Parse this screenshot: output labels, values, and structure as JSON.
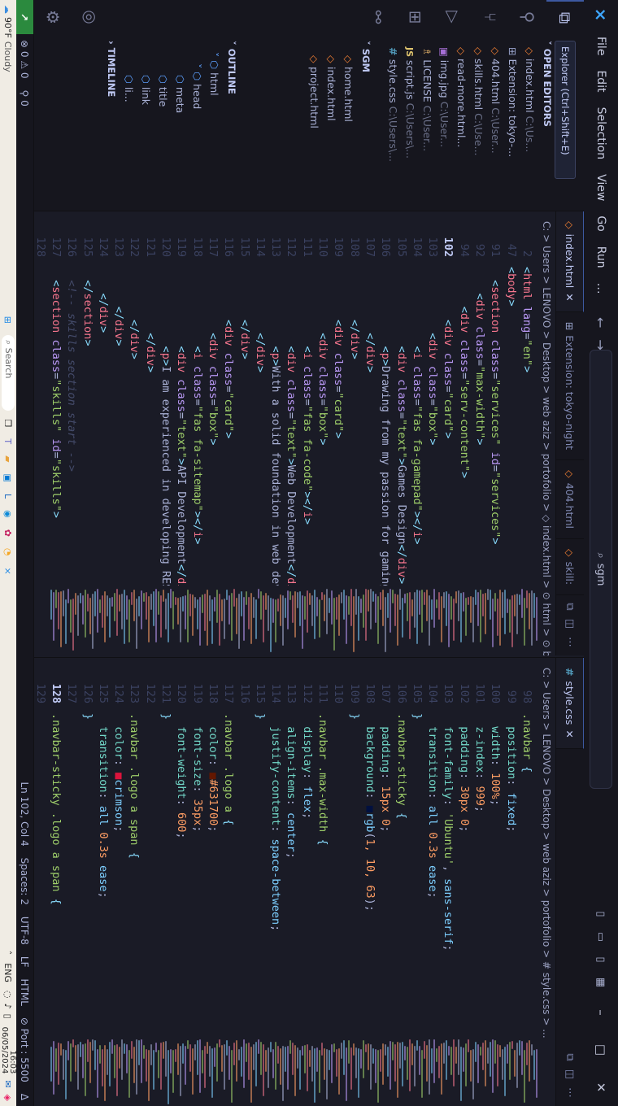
{
  "titlebar": {
    "menu": [
      "File",
      "Edit",
      "Selection",
      "View",
      "Go",
      "Run",
      "…"
    ],
    "search_text": "sgm",
    "win_min": "–",
    "win_max": "□",
    "win_close": "✕"
  },
  "tooltip": "Explorer (Ctrl+Shift+E)",
  "sidebar": {
    "open_editors_title": "OPEN EDITORS",
    "open_editors": [
      {
        "name": "index.html",
        "path": "C:\\Us...",
        "icon": "html"
      },
      {
        "name": "Extension: tokyo-...",
        "path": "",
        "icon": "ext"
      },
      {
        "name": "404.html",
        "path": "C:\\User...",
        "icon": "html"
      },
      {
        "name": "skills.html",
        "path": "C:\\Use...",
        "icon": "html"
      },
      {
        "name": "read-more.html...",
        "path": "",
        "icon": "html"
      },
      {
        "name": "img.jpg",
        "path": "C:\\User...",
        "icon": "img"
      },
      {
        "name": "LICENSE",
        "path": "C:\\User...",
        "icon": "lic"
      },
      {
        "name": "script.js",
        "path": "C:\\Users\\...",
        "icon": "js"
      },
      {
        "name": "style.css",
        "path": "C:\\Users\\...",
        "icon": "css"
      }
    ],
    "sgm_title": "SGM",
    "sgm_files": [
      "home.html",
      "index.html",
      "project.html"
    ],
    "outline_title": "OUTLINE",
    "outline": [
      {
        "label": "html",
        "indent": 1
      },
      {
        "label": "head",
        "indent": 2
      },
      {
        "label": "meta",
        "indent": 3
      },
      {
        "label": "title",
        "indent": 3
      },
      {
        "label": "link",
        "indent": 3
      },
      {
        "label": "li...",
        "indent": 3
      }
    ],
    "timeline_title": "TIMELINE"
  },
  "editor_left": {
    "tabs": [
      {
        "label": "index.html",
        "active": true,
        "icon": "html",
        "close": "✕"
      },
      {
        "label": "Extension: tokyo-night",
        "active": false,
        "icon": "ext"
      },
      {
        "label": "404.html",
        "active": false,
        "icon": "html"
      },
      {
        "label": "skill:",
        "active": false,
        "icon": "html"
      }
    ],
    "breadcrumb": "C: > Users > LENOVO > Desktop > web aziz > portofolio > ◇ index.html > ⊙ html > ⊙ body >",
    "lines": [
      {
        "n": "2",
        "html": "<span class='br'>&lt;</span><span class='tg'>html</span> <span class='at'>lang</span>=<span class='st'>\"en\"</span><span class='br'>&gt;</span>"
      },
      {
        "n": "47",
        "html": "<span class='br'>&lt;</span><span class='tg'>body</span><span class='br'>&gt;</span>"
      },
      {
        "n": "91",
        "html": "  <span class='br'>&lt;</span><span class='tg'>section</span> <span class='at'>class</span>=<span class='st'>\"services\"</span> <span class='at'>id</span>=<span class='st'>\"services\"</span><span class='br'>&gt;</span>"
      },
      {
        "n": "92",
        "html": "    <span class='br'>&lt;</span><span class='tg'>div</span> <span class='at'>class</span>=<span class='st'>\"max-width\"</span><span class='br'>&gt;</span>"
      },
      {
        "n": "94",
        "html": "      <span class='br'>&lt;</span><span class='tg'>div</span> <span class='at'>class</span>=<span class='st'>\"serv-content\"</span><span class='br'>&gt;</span>"
      },
      {
        "n": "102",
        "html": "        <span class='br'>&lt;</span><span class='tg'>div</span> <span class='at'>class</span>=<span class='st'>\"card\"</span><span class='br'>&gt;</span>"
      },
      {
        "n": "103",
        "html": "          <span class='br'>&lt;</span><span class='tg'>div</span> <span class='at'>class</span>=<span class='st'>\"box\"</span><span class='br'>&gt;</span>"
      },
      {
        "n": "104",
        "html": "            <span class='br'>&lt;</span><span class='tg'>i</span> <span class='at'>class</span>=<span class='st'>\"fas fa-gamepad\"</span><span class='br'>&gt;&lt;/</span><span class='tg'>i</span><span class='br'>&gt;</span>"
      },
      {
        "n": "105",
        "html": "            <span class='br'>&lt;</span><span class='tg'>div</span> <span class='at'>class</span>=<span class='st'>\"text\"</span><span class='br'>&gt;</span>Games Design<span class='br'>&lt;/</span><span class='tg'>div</span><span class='br'>&gt;</span>"
      },
      {
        "n": "106",
        "html": "            <span class='br'>&lt;</span><span class='tg'>p</span><span class='br'>&gt;</span>Drawing from my passion for gaming and ex"
      },
      {
        "n": "107",
        "html": "          <span class='br'>&lt;/</span><span class='tg'>div</span><span class='br'>&gt;</span>"
      },
      {
        "n": "108",
        "html": "        <span class='br'>&lt;/</span><span class='tg'>div</span><span class='br'>&gt;</span>"
      },
      {
        "n": "109",
        "html": "        <span class='br'>&lt;</span><span class='tg'>div</span> <span class='at'>class</span>=<span class='st'>\"card\"</span><span class='br'>&gt;</span>"
      },
      {
        "n": "110",
        "html": "          <span class='br'>&lt;</span><span class='tg'>div</span> <span class='at'>class</span>=<span class='st'>\"box\"</span><span class='br'>&gt;</span>"
      },
      {
        "n": "111",
        "html": "            <span class='br'>&lt;</span><span class='tg'>i</span> <span class='at'>class</span>=<span class='st'>\"fas fa-code\"</span><span class='br'>&gt;&lt;/</span><span class='tg'>i</span><span class='br'>&gt;</span>"
      },
      {
        "n": "112",
        "html": "            <span class='br'>&lt;</span><span class='tg'>div</span> <span class='at'>class</span>=<span class='st'>\"text\"</span><span class='br'>&gt;</span>Web Development<span class='br'>&lt;/</span><span class='tg'>div</span><span class='br'>&gt;</span>"
      },
      {
        "n": "113",
        "html": "            <span class='br'>&lt;</span><span class='tg'>p</span><span class='br'>&gt;</span>With a solid foundation in web developmer"
      },
      {
        "n": "114",
        "html": "          <span class='br'>&lt;/</span><span class='tg'>div</span><span class='br'>&gt;</span>"
      },
      {
        "n": "115",
        "html": "        <span class='br'>&lt;/</span><span class='tg'>div</span><span class='br'>&gt;</span>"
      },
      {
        "n": "116",
        "html": "        <span class='br'>&lt;</span><span class='tg'>div</span> <span class='at'>class</span>=<span class='st'>\"card\"</span><span class='br'>&gt;</span>"
      },
      {
        "n": "117",
        "html": "          <span class='br'>&lt;</span><span class='tg'>div</span> <span class='at'>class</span>=<span class='st'>\"box\"</span><span class='br'>&gt;</span>"
      },
      {
        "n": "118",
        "html": "            <span class='br'>&lt;</span><span class='tg'>i</span> <span class='at'>class</span>=<span class='st'>\"fas fa-sitemap\"</span><span class='br'>&gt;&lt;/</span><span class='tg'>i</span><span class='br'>&gt;</span>"
      },
      {
        "n": "119",
        "html": "            <span class='br'>&lt;</span><span class='tg'>div</span> <span class='at'>class</span>=<span class='st'>\"text\"</span><span class='br'>&gt;</span>API Development<span class='br'>&lt;/</span><span class='tg'>div</span><span class='br'>&gt;</span>"
      },
      {
        "n": "120",
        "html": "            <span class='br'>&lt;</span><span class='tg'>p</span><span class='br'>&gt;</span>I am experienced in developing RESTful AP"
      },
      {
        "n": "121",
        "html": "          <span class='br'>&lt;/</span><span class='tg'>div</span><span class='br'>&gt;</span>"
      },
      {
        "n": "122",
        "html": "        <span class='br'>&lt;/</span><span class='tg'>div</span><span class='br'>&gt;</span>"
      },
      {
        "n": "123",
        "html": "      <span class='br'>&lt;/</span><span class='tg'>div</span><span class='br'>&gt;</span>"
      },
      {
        "n": "124",
        "html": "    <span class='br'>&lt;/</span><span class='tg'>div</span><span class='br'>&gt;</span>"
      },
      {
        "n": "125",
        "html": "  <span class='br'>&lt;/</span><span class='tg'>section</span><span class='br'>&gt;</span>"
      },
      {
        "n": "126",
        "html": "  <span class='cm'>&lt;!-- skills section start --&gt;</span>"
      },
      {
        "n": "127",
        "html": "  <span class='br'>&lt;</span><span class='tg'>section</span> <span class='at'>class</span>=<span class='st'>\"skills\"</span> <span class='at'>id</span>=<span class='st'>\"skills\"</span><span class='br'>&gt;</span>"
      },
      {
        "n": "128",
        "html": ""
      }
    ]
  },
  "editor_right": {
    "tabs": [
      {
        "label": "style.css",
        "active": true,
        "icon": "css",
        "close": "✕"
      }
    ],
    "breadcrumb": "C: > Users > LENOVO > Desktop > web aziz > portofolio > # style.css > ...",
    "lines": [
      {
        "n": "98",
        "html": "<span class='sel'>.navbar</span> <span class='br'>{</span>"
      },
      {
        "n": "99",
        "html": "  <span class='pr'>position</span>: <span class='kw'>fixed</span>;"
      },
      {
        "n": "100",
        "html": "  <span class='pr'>width</span>: <span class='vl'>100%</span>;"
      },
      {
        "n": "101",
        "html": "  <span class='pr'>z-index</span>: <span class='vl'>999</span>;"
      },
      {
        "n": "102",
        "html": "  <span class='pr'>padding</span>: <span class='vl'>30px 0</span>;"
      },
      {
        "n": "103",
        "html": "  <span class='pr'>font-family</span>: <span class='st'>'Ubuntu'</span>, <span class='kw'>sans-serif</span>;"
      },
      {
        "n": "104",
        "html": "  <span class='pr'>transition</span>: <span class='kw'>all</span> <span class='vl'>0.3s</span> <span class='kw'>ease</span>;"
      },
      {
        "n": "105",
        "html": "<span class='br'>}</span>"
      },
      {
        "n": "106",
        "html": "<span class='sel'>.navbar.sticky</span> <span class='br'>{</span>"
      },
      {
        "n": "107",
        "html": "  <span class='pr'>padding</span>: <span class='vl'>15px 0</span>;"
      },
      {
        "n": "108",
        "html": "  <span class='pr'>background</span>: <span style='color:#01103f'>■</span><span class='kw'>rgb</span>(<span class='vl'>1, 10, 63</span>);"
      },
      {
        "n": "109",
        "html": "<span class='br'>}</span>"
      },
      {
        "n": "110",
        "html": ""
      },
      {
        "n": "111",
        "html": "<span class='sel'>.navbar .max-width</span> <span class='br'>{</span>"
      },
      {
        "n": "112",
        "html": "  <span class='pr'>display</span>: <span class='kw'>flex</span>;"
      },
      {
        "n": "113",
        "html": "  <span class='pr'>align-items</span>: <span class='kw'>center</span>;"
      },
      {
        "n": "114",
        "html": "  <span class='pr'>justify-content</span>: <span class='kw'>space-between</span>;"
      },
      {
        "n": "115",
        "html": "<span class='br'>}</span>"
      },
      {
        "n": "116",
        "html": ""
      },
      {
        "n": "117",
        "html": "<span class='sel'>.navbar .logo a</span> <span class='br'>{</span>"
      },
      {
        "n": "118",
        "html": "  <span class='pr'>color</span>: <span style='color:#631700'>■</span><span class='vl'>#631700</span>;"
      },
      {
        "n": "119",
        "html": "  <span class='pr'>font-size</span>: <span class='vl'>35px</span>;"
      },
      {
        "n": "120",
        "html": "  <span class='pr'>font-weight</span>: <span class='vl'>600</span>;"
      },
      {
        "n": "121",
        "html": "<span class='br'>}</span>"
      },
      {
        "n": "122",
        "html": ""
      },
      {
        "n": "123",
        "html": "<span class='sel'>.navbar .logo a span</span> <span class='br'>{</span>"
      },
      {
        "n": "124",
        "html": "  <span class='pr'>color</span>: <span style='color:#dc143c'>■</span><span class='kw'>crimson</span>;"
      },
      {
        "n": "125",
        "html": "  <span class='pr'>transition</span>: <span class='kw'>all</span> <span class='vl'>0.3s</span> <span class='kw'>ease</span>;"
      },
      {
        "n": "126",
        "html": "<span class='br'>}</span>"
      },
      {
        "n": "127",
        "html": ""
      },
      {
        "n": "128",
        "html": "<span class='sel'>.navbar-sticky .logo a span</span> <span class='br'>{</span>"
      },
      {
        "n": "129",
        "html": ""
      }
    ]
  },
  "statusbar": {
    "remote": "↗",
    "problems": "⊗ 0 ⚠ 0",
    "ports": "⚲ 0",
    "position": "Ln 102, Col 4",
    "spaces": "Spaces: 2",
    "encoding": "UTF-8",
    "eol": "LF",
    "language": "HTML",
    "port": "⊘ Port : 5500",
    "bell": "Δ"
  },
  "taskbar": {
    "weather_temp": "90°F",
    "weather_desc": "Cloudy",
    "search_placeholder": "Search",
    "lang": "ENG",
    "time": "16:03",
    "date": "06/05/2024"
  },
  "colors": {
    "accent": "#3d59a1",
    "remote_bg": "#2b8a3e",
    "editor_bg": "#1a1b26",
    "panel_bg": "#16161e"
  }
}
